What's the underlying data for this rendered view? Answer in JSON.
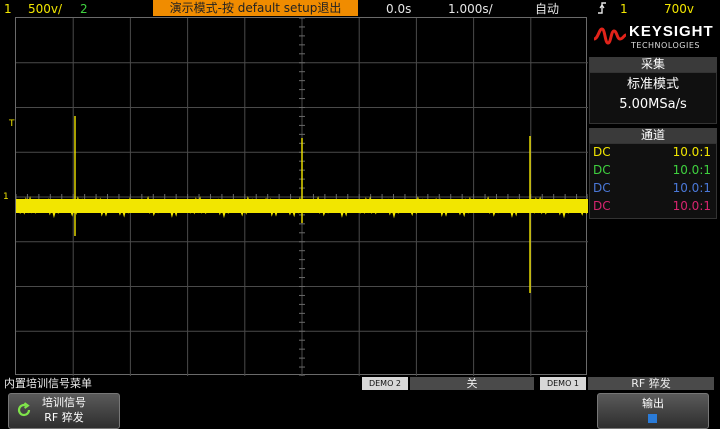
{
  "topbar": {
    "ch1_num": "1",
    "ch1_scale": "500v/",
    "ch2_num": "2",
    "banner": "演示模式-按 default setup退出",
    "time_delay": "0.0s",
    "time_scale": "1.000s/",
    "trigger_mode": "自动",
    "trigger_icon": "trigger-edge-icon",
    "trigger_source": "1",
    "trigger_level": "700v"
  },
  "colors": {
    "ch1": "#f2e600",
    "ch2": "#3fd13f",
    "ch3": "#4a78d8",
    "ch4": "#d6246e",
    "banner": "#f08c00",
    "brand_red": "#e2231a"
  },
  "graticule": {
    "markers": {
      "trigger": "T",
      "ground": "1"
    }
  },
  "panel": {
    "brand": "KEYSIGHT",
    "brand_sub": "TECHNOLOGIES",
    "acq_title": "采集",
    "acq_mode": "标准模式",
    "acq_rate": "5.00MSa/s",
    "ch_title": "通道",
    "channels": [
      {
        "coupling": "DC",
        "probe": "10.0:1"
      },
      {
        "coupling": "DC",
        "probe": "10.0:1"
      },
      {
        "coupling": "DC",
        "probe": "10.0:1"
      },
      {
        "coupling": "DC",
        "probe": "10.0:1"
      }
    ]
  },
  "menu": {
    "title": "内置培训信号菜单",
    "demo2_tag": "DEMO 2",
    "demo2_value": "关",
    "demo1_tag": "DEMO 1",
    "demo1_value": "RF 猝发"
  },
  "softkeys": {
    "signal_label": "培训信号",
    "signal_value": "RF 猝发",
    "output_label": "输出"
  }
}
